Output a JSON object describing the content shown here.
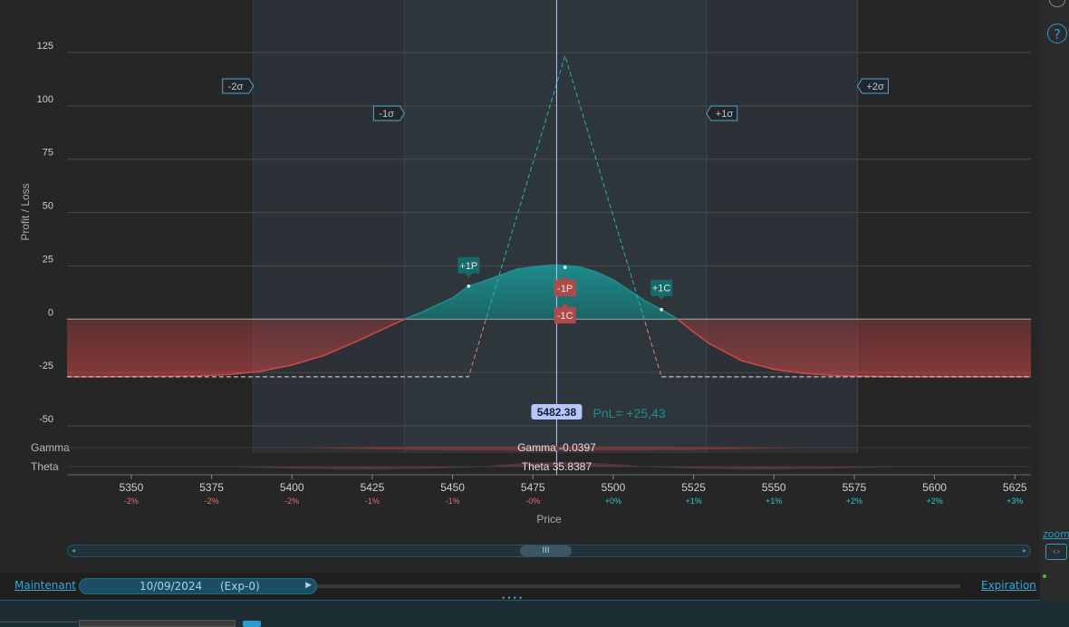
{
  "chart_data": {
    "type": "line",
    "xlabel": "Price",
    "ylabel": "Profit / Loss",
    "xlim": [
      5330,
      5630
    ],
    "ylim": [
      -50,
      125
    ],
    "yticks": [
      125,
      100,
      75,
      50,
      25,
      0,
      -25,
      -50
    ],
    "xticks": [
      {
        "value": 5350,
        "label": "5350",
        "pct": "-2%"
      },
      {
        "value": 5375,
        "label": "5375",
        "pct": "-2%"
      },
      {
        "value": 5400,
        "label": "5400",
        "pct": "-2%"
      },
      {
        "value": 5425,
        "label": "5425",
        "pct": "-1%"
      },
      {
        "value": 5450,
        "label": "5450",
        "pct": "-1%"
      },
      {
        "value": 5475,
        "label": "5475",
        "pct": "-0%"
      },
      {
        "value": 5500,
        "label": "5500",
        "pct": "+0%"
      },
      {
        "value": 5525,
        "label": "5525",
        "pct": "+1%"
      },
      {
        "value": 5550,
        "label": "5550",
        "pct": "+1%"
      },
      {
        "value": 5575,
        "label": "5575",
        "pct": "+2%"
      },
      {
        "value": 5600,
        "label": "5600",
        "pct": "+2%"
      },
      {
        "value": 5625,
        "label": "5625",
        "pct": "+3%"
      }
    ],
    "series": [
      {
        "curve": "current",
        "x": [
          5330,
          5340,
          5350,
          5360,
          5370,
          5380,
          5390,
          5400,
          5410,
          5420,
          5430,
          5435,
          5440,
          5450,
          5455,
          5460,
          5470,
          5475,
          5480,
          5482.38,
          5485,
          5490,
          5495,
          5500,
          5510,
          5515,
          5520,
          5525,
          5530,
          5540,
          5550,
          5560,
          5570,
          5580,
          5590,
          5600,
          5610,
          5620,
          5630
        ],
        "y": [
          -27,
          -27,
          -26.9,
          -26.8,
          -26.6,
          -26,
          -24.5,
          -21.5,
          -17,
          -10.5,
          -3.5,
          0,
          3,
          10,
          15.5,
          18,
          23.5,
          24.5,
          25.3,
          25.43,
          25.2,
          24.3,
          22,
          18.5,
          8.5,
          4.5,
          0,
          -6,
          -11.5,
          -19.5,
          -23.5,
          -25.5,
          -26.4,
          -26.8,
          -27,
          -27,
          -27,
          -27,
          -27
        ]
      },
      {
        "curve": "expiration",
        "x": [
          5330,
          5455,
          5485,
          5515,
          5630
        ],
        "y": [
          -27,
          -27,
          123.5,
          -27,
          -27
        ]
      }
    ],
    "current_price": {
      "value": 5482.38,
      "label": "5482.38",
      "pnl_label": "PnL= +25,43"
    },
    "sigma_bands": [
      {
        "label": "-2σ",
        "value": 5388,
        "row": 2
      },
      {
        "label": "-1σ",
        "value": 5435,
        "row": 1
      },
      {
        "label": "+1σ",
        "value": 5529,
        "row": 1
      },
      {
        "label": "+2σ",
        "value": 5576,
        "row": 2
      }
    ],
    "legs": [
      {
        "label": "+1P",
        "x": 5455,
        "y": 15.5,
        "kind": "long"
      },
      {
        "label": "-1P",
        "x": 5485,
        "y": 8,
        "kind": "short"
      },
      {
        "label": "-1C",
        "x": 5485,
        "y": -5,
        "kind": "short"
      },
      {
        "label": "+1C",
        "x": 5515,
        "y": 4.5,
        "kind": "long"
      }
    ],
    "greeks": [
      {
        "name": "Gamma",
        "readout": "Gamma -0.0397"
      },
      {
        "name": "Theta",
        "readout": "Theta 35.8387"
      }
    ]
  },
  "colors": {
    "profit": "#1e8f8f",
    "loss": "#d04848",
    "price_line": "#b7c6ff",
    "accent": "#2a9bd0",
    "sigma_box": "#4da4d8"
  },
  "controls": {
    "help_label": "?",
    "zoom_label": "zoom",
    "zoom_icon": "‹›",
    "scroll_thumb_icon": "III",
    "now_link": "Maintenant",
    "date_value": "10/09/2024",
    "exp_value": "(Exp-0)",
    "expiration_link": "Expiration",
    "drag_handle": "••••"
  }
}
